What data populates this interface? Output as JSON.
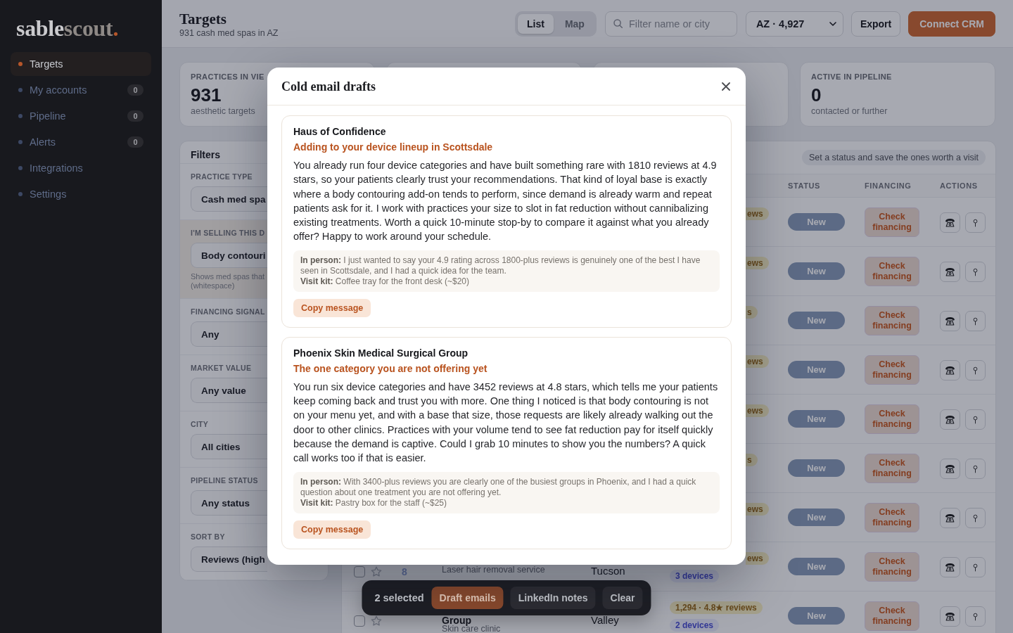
{
  "sidebar": {
    "logo": [
      {
        "text": "sable",
        "kind": "light"
      },
      {
        "text": "scout",
        "kind": "muted"
      },
      {
        "text": ".",
        "kind": "accent"
      }
    ],
    "items": [
      {
        "label": "Targets",
        "selected": true
      },
      {
        "label": "My accounts",
        "selected": false,
        "count": "0"
      },
      {
        "label": "Pipeline",
        "selected": false,
        "count": "0"
      },
      {
        "label": "Alerts",
        "selected": false,
        "count": "0"
      },
      {
        "label": "Integrations",
        "selected": false
      },
      {
        "label": "Settings",
        "selected": false
      }
    ]
  },
  "header": {
    "title": "Targets",
    "subtitle": "931 cash med spas in AZ",
    "view_toggle": [
      {
        "label": "List",
        "selected": true
      },
      {
        "label": "Map",
        "selected": false
      }
    ],
    "search": {
      "placeholder": "Filter name or city"
    },
    "region_select": {
      "value": "AZ · 4,927"
    },
    "buttons": [
      {
        "label": "Export",
        "kind": "secondary"
      },
      {
        "label": "Connect CRM",
        "kind": "primary"
      }
    ]
  },
  "stats": [
    {
      "kind": "metric",
      "label": "PRACTICES IN VIE",
      "value": "931",
      "caption": "aesthetic targets"
    },
    {
      "kind": "covered"
    },
    {
      "kind": "covered"
    },
    {
      "kind": "metric",
      "label": "ACTIVE IN PIPELINE",
      "value": "0",
      "caption": "contacted or further"
    }
  ],
  "filters": {
    "title": "Filters",
    "groups": [
      {
        "label": "PRACTICE TYPE",
        "value": "Cash med spa",
        "highlighted": false
      },
      {
        "label": "I'M SELLING THIS D",
        "value": "Body contouri",
        "highlighted": true,
        "hint_lines": [
          "Shows med spas that",
          "(whitespace)"
        ]
      },
      {
        "label": "FINANCING SIGNAL",
        "value": "Any",
        "highlighted": false
      },
      {
        "label": "MARKET VALUE",
        "value": "Any value",
        "highlighted": false
      },
      {
        "label": "CITY",
        "value": "All cities",
        "highlighted": false
      },
      {
        "label": "PIPELINE STATUS",
        "value": "Any status",
        "highlighted": false
      },
      {
        "label": "SORT BY",
        "value": "Reviews (high",
        "highlighted": false
      }
    ]
  },
  "table": {
    "hint": "Set a status and save the ones worth a visit",
    "columns": [
      "STATUS",
      "FINANCING",
      "ACTIONS"
    ],
    "rows": [
      {
        "reviews": {
          "text": "ews",
          "cut": true
        },
        "status": "New",
        "financing": "Check financing"
      },
      {
        "reviews": {
          "text": "ews",
          "cut": true
        },
        "status": "New",
        "financing": "Check financing"
      },
      {
        "reviews": {
          "text": "s",
          "cut": true
        },
        "status": "New",
        "financing": "Check financing"
      },
      {
        "reviews": {
          "text": "ews",
          "cut": true
        },
        "status": "New",
        "financing": "Check financing"
      },
      {
        "reviews": {
          "text": "ews",
          "cut": true
        },
        "status": "New",
        "financing": "Check financing"
      },
      {
        "reviews": {
          "text": "s",
          "cut": true
        },
        "status": "New",
        "financing": "Check financing"
      },
      {
        "reviews": {
          "text": "ews",
          "cut": true
        },
        "status": "New",
        "financing": "Check financing"
      },
      {
        "checked": false,
        "starred": false,
        "number": "8",
        "subtitle": "Laser hair removal service",
        "city": "Tucson",
        "reviews": {
          "text": "ews",
          "cut": true
        },
        "devices": "3 devices",
        "status": "New",
        "financing": "Check financing"
      },
      {
        "checked": false,
        "starred": false,
        "name": "Group",
        "subtitle": "Skin care clinic",
        "city": "Valley",
        "reviews": {
          "text": "1,294 · 4.8★ reviews",
          "cut": false
        },
        "devices": "2 devices",
        "status": "New",
        "financing": "Check financing"
      }
    ]
  },
  "selection_bar": {
    "count_label": "2 selected",
    "buttons": [
      {
        "label": "Draft emails",
        "kind": "primary"
      },
      {
        "label": "LinkedIn notes",
        "kind": "secondary"
      },
      {
        "label": "Clear",
        "kind": "secondary"
      }
    ]
  },
  "modal": {
    "title": "Cold email drafts",
    "drafts": [
      {
        "practice": "Haus of Confidence",
        "subject": "Adding to your device lineup in Scottsdale",
        "body": "You already run four device categories and have built something rare with 1810 reviews at 4.9 stars, so your patients clearly trust your recommendations. That kind of loyal base is exactly where a body contouring add-on tends to perform, since demand is already warm and repeat patients ask for it. I work with practices your size to slot in fat reduction without cannibalizing existing treatments. Worth a quick 10-minute stop-by to compare it against what you already offer? Happy to work around your schedule.",
        "in_person": "**In person:** I just wanted to say your 4.9 rating across 1800-plus reviews is genuinely one of the best I have seen in Scottsdale, and I had a quick idea for the team.",
        "visit_kit": "**Visit kit:** Coffee tray for the front desk (~$20)",
        "copy_label": "Copy message"
      },
      {
        "practice": "Phoenix Skin Medical Surgical Group",
        "subject": "The one category you are not offering yet",
        "body": "You run six device categories and have 3452 reviews at 4.8 stars, which tells me your patients keep coming back and trust you with more. One thing I noticed is that body contouring is not on your menu yet, and with a base that size, those requests are likely already walking out the door to other clinics. Practices with your volume tend to see fat reduction pay for itself quickly because the demand is captive. Could I grab 10 minutes to show you the numbers? A quick call works too if that is easier.",
        "in_person": "**In person:** With 3400-plus reviews you are clearly one of the busiest groups in Phoenix, and I had a quick question about one treatment you are not offering yet.",
        "visit_kit": "**Visit kit:** Pastry box for the staff (~$25)",
        "copy_label": "Copy message"
      }
    ]
  }
}
